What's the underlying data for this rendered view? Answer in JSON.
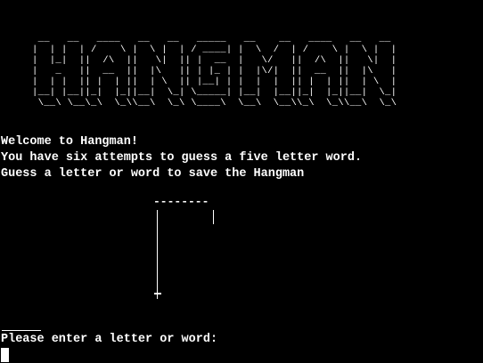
{
  "banner": {
    "text": "HANGMAN",
    "ascii_lines": [
      " __   __   ____   __   __   _____   __    __   ____   __   __",
      "|  | |  | /    \\ |  \\ |  | / ____| |  \\  /  | /    \\ |  \\ |  |",
      "|  |_|  ||  /\\  ||   \\|  || |  __  |   \\/   ||  /\\  ||   \\|  |",
      "|   _   ||  __  ||  |\\   || | |_ | |  |\\/|  ||  __  ||  |\\   |",
      "|  | |  || |  | ||  | \\  || |__| | |  |  |  || |  | ||  | \\  |",
      "|__| |__||_|  |_||__|  \\_| \\_____| |__|  |__||_|  |_||__|  \\_|",
      " \\__\\ \\__\\_\\  \\_\\\\__\\  \\_\\ \\____\\  \\__\\  \\__\\\\_\\  \\_\\\\__\\  \\_\\"
    ]
  },
  "messages": {
    "welcome": "Welcome to Hangman!",
    "attempts": "You have six attempts to guess a five letter word.",
    "instruction": "Guess a letter or word to save the Hangman"
  },
  "gallows": {
    "beam": "--------"
  },
  "prompt": {
    "text": "Please enter a letter or word:"
  }
}
